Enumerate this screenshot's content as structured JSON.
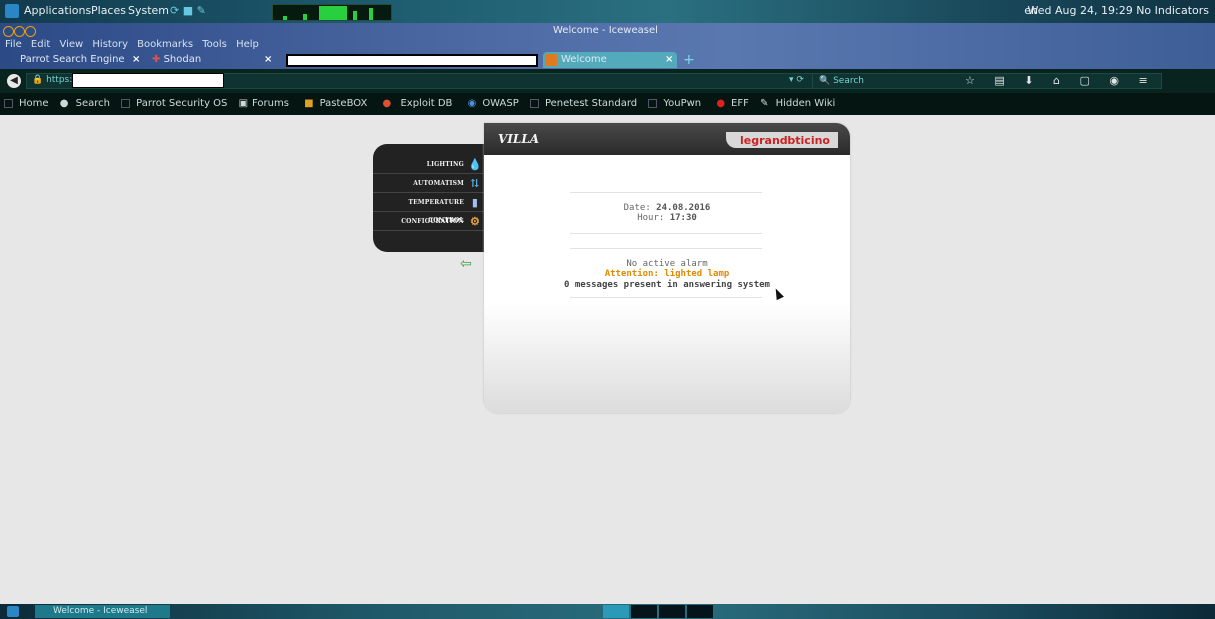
{
  "system_panel": {
    "menus": [
      "Applications",
      "Places",
      "System"
    ],
    "language": "en",
    "clock": "Wed Aug 24, 19:29",
    "indicators": "No Indicators"
  },
  "window": {
    "title": "Welcome - Iceweasel",
    "menubar": [
      "File",
      "Edit",
      "View",
      "History",
      "Bookmarks",
      "Tools",
      "Help"
    ]
  },
  "tabs": [
    {
      "label": "Parrot Search Engine"
    },
    {
      "label": "Shodan"
    },
    {
      "label": ""
    },
    {
      "label": "Welcome"
    }
  ],
  "navbar": {
    "url_prefix": "https://",
    "search_placeholder": "Search"
  },
  "bookmarks": [
    "Home",
    "Search",
    "Parrot Security OS",
    "Forums",
    "PasteBOX",
    "Exploit DB",
    "OWASP",
    "Penetest Standard",
    "YouPwn",
    "EFF",
    "Hidden Wiki"
  ],
  "page": {
    "title": "VILLA",
    "brand_left": "legrand",
    "brand_right": "bticino",
    "menu": [
      {
        "label": "LIGHTING",
        "icon": "bulb-icon"
      },
      {
        "label": "AUTOMATISM",
        "icon": "shutter-icon"
      },
      {
        "label": "TEMPERATURE CONTROL",
        "icon": "thermometer-icon"
      },
      {
        "label": "CONFIGURATION",
        "icon": "gear-icon"
      }
    ],
    "date_label": "Date:",
    "date_value": "24.08.2016",
    "hour_label": "Hour:",
    "hour_value": "17:30",
    "alarm_status": "No active alarm",
    "attention": "Attention: lighted lamp",
    "messages": "0 messages present in answering system"
  },
  "taskbar": {
    "task_label": "Welcome - Iceweasel"
  }
}
